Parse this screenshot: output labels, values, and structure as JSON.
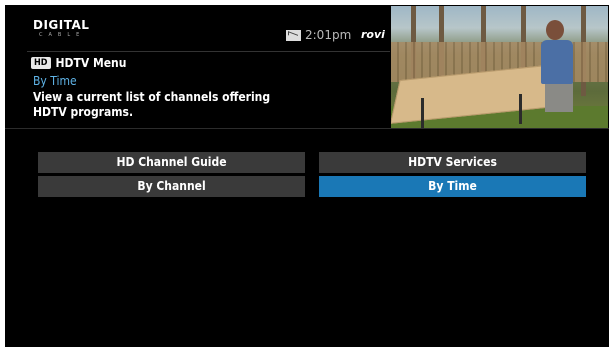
{
  "header": {
    "logo_main": "DIGITAL",
    "logo_sub": "CABLE",
    "time": "2:01pm",
    "brand": "rovi",
    "mail_icon": "mail-icon"
  },
  "menu": {
    "badge": "HD",
    "title": "HDTV Menu",
    "selection": "By Time",
    "description": "View a current list of channels offering HDTV programs."
  },
  "buttons": {
    "hd_channel_guide": "HD Channel Guide",
    "by_channel": "By Channel",
    "hdtv_services": "HDTV Services",
    "by_time": "By Time"
  },
  "colors": {
    "selected": "#1a78b6",
    "button": "#3a3a3a",
    "highlight_text": "#5fb3e6"
  }
}
